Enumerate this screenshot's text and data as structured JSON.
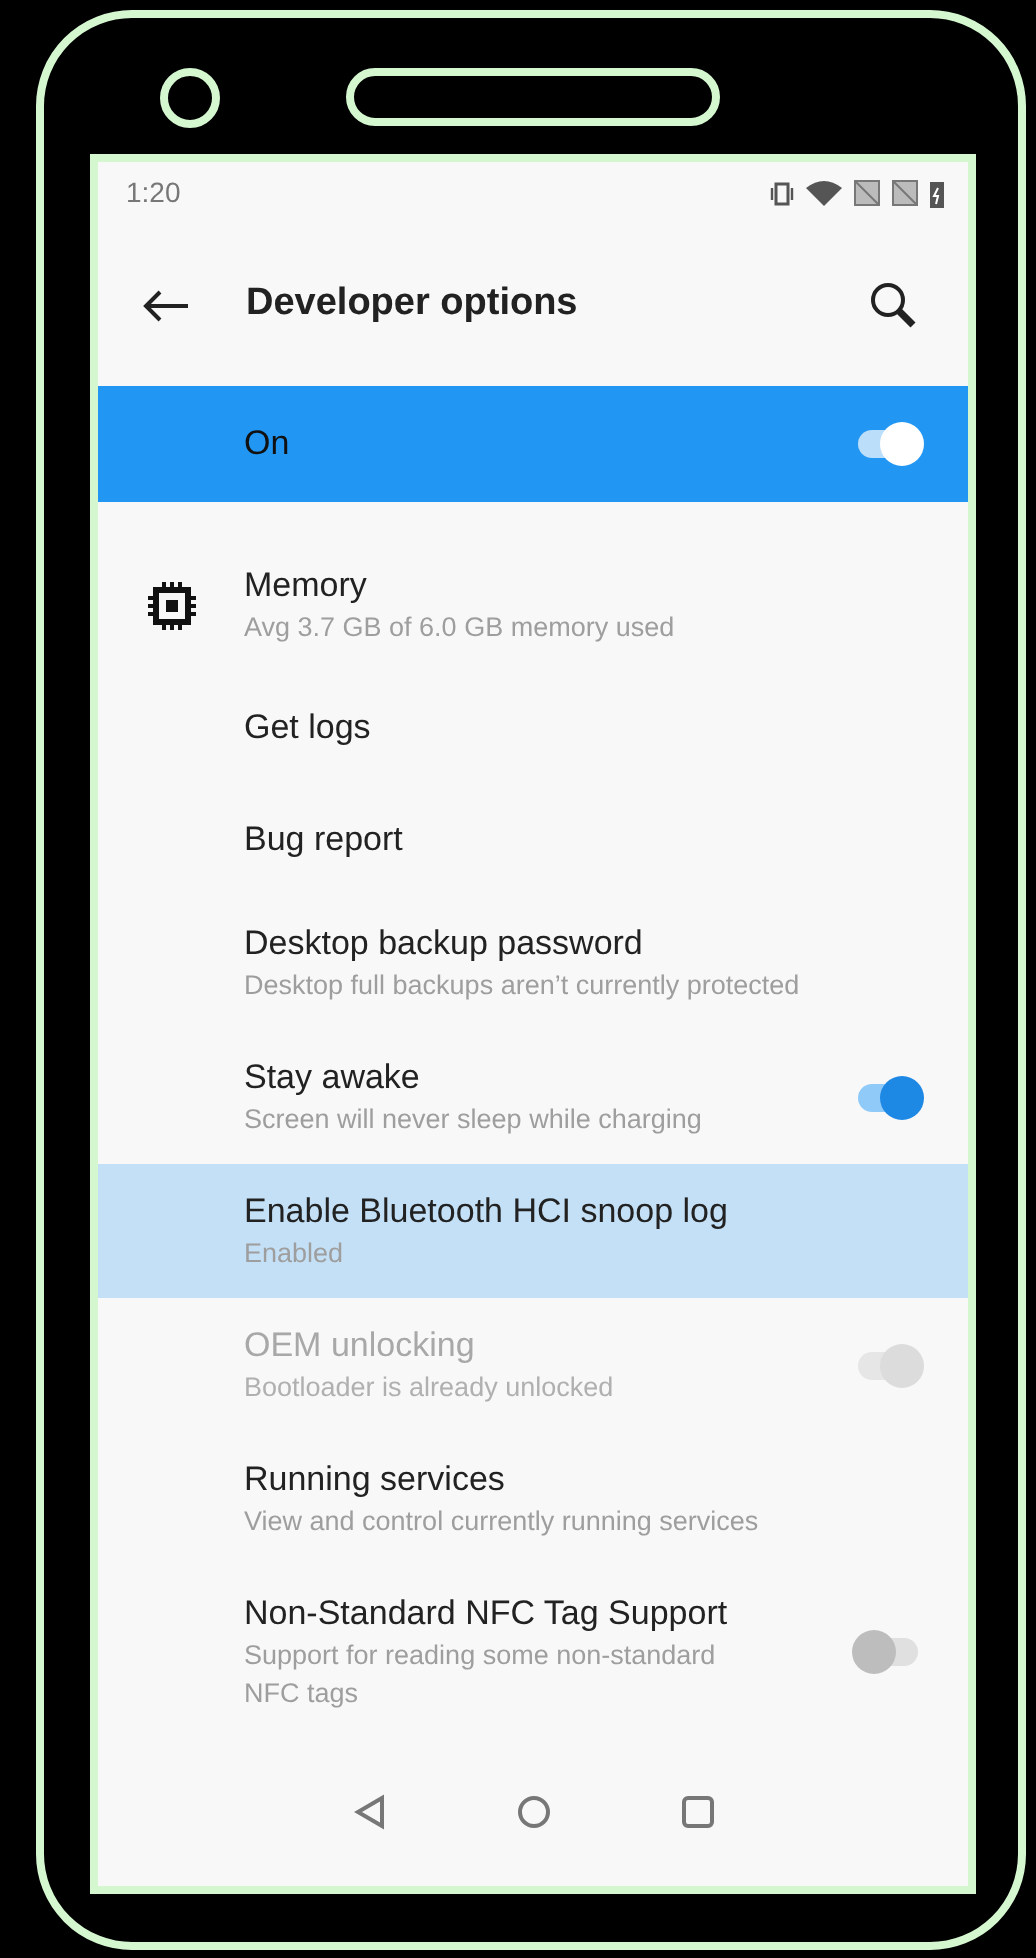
{
  "status_bar": {
    "time": "1:20"
  },
  "toolbar": {
    "title": "Developer options"
  },
  "master_switch": {
    "label": "On",
    "on": true
  },
  "items": [
    {
      "kind": "icon",
      "title": "Memory",
      "summary": "Avg 3.7 GB of 6.0 GB memory used",
      "selected": false,
      "disabled": false
    },
    {
      "kind": "plain",
      "title": "Get logs",
      "selected": false,
      "disabled": false
    },
    {
      "kind": "plain",
      "title": "Bug report",
      "selected": false,
      "disabled": false
    },
    {
      "kind": "plain",
      "title": "Desktop backup password",
      "summary": "Desktop full backups aren’t currently protected",
      "selected": false,
      "disabled": false
    },
    {
      "kind": "switch",
      "title": "Stay awake",
      "summary": "Screen will never sleep while charging",
      "on": true,
      "selected": false,
      "disabled": false
    },
    {
      "kind": "plain",
      "title": "Enable Bluetooth HCI snoop log",
      "summary": "Enabled",
      "selected": true,
      "disabled": false
    },
    {
      "kind": "switch",
      "title": "OEM unlocking",
      "summary": "Bootloader is already unlocked",
      "on": true,
      "selected": false,
      "disabled": true
    },
    {
      "kind": "plain",
      "title": "Running services",
      "summary": "View and control currently running services",
      "selected": false,
      "disabled": false
    },
    {
      "kind": "switch",
      "title": "Non-Standard NFC Tag Support",
      "summary": "Support for reading some non-standard NFC tags",
      "on": false,
      "selected": false,
      "disabled": false
    }
  ]
}
